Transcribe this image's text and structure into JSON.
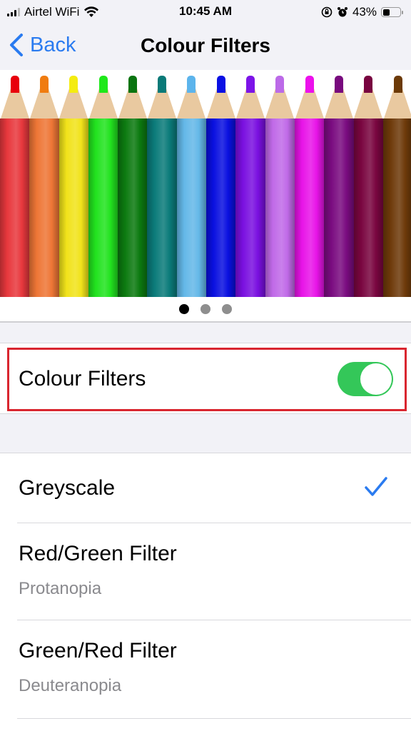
{
  "status_bar": {
    "carrier": "Airtel WiFi",
    "time": "10:45 AM",
    "battery_percent": "43%",
    "battery_level": 0.43,
    "icons": [
      "signal-icon",
      "wifi-icon",
      "orientation-lock-icon",
      "alarm-icon",
      "battery-icon"
    ]
  },
  "nav": {
    "back_label": "Back",
    "title": "Colour Filters"
  },
  "preview": {
    "pencil_colors": [
      "#e8383d",
      "#ee7636",
      "#f1e31a",
      "#22e31f",
      "#0c7a10",
      "#0b7b7a",
      "#64b8e8",
      "#0a10e0",
      "#7a10e0",
      "#c06ae8",
      "#e814e8",
      "#7a0c80",
      "#7a0640",
      "#6e3a0a"
    ],
    "lead_colors": [
      "#e8000c",
      "#f07c10",
      "#f4ec10",
      "#1ee81a",
      "#0a7410",
      "#0a7a78",
      "#5cb4ec",
      "#0a10e4",
      "#7c14e8",
      "#bc6ae8",
      "#ec10ec",
      "#780a7e",
      "#780440",
      "#6c3a08"
    ],
    "page_count": 3,
    "current_page": 1
  },
  "colour_filters": {
    "label": "Colour Filters",
    "enabled": true,
    "toggle_color": "#34c759",
    "highlight_color": "#d9262f"
  },
  "filters": [
    {
      "title": "Greyscale",
      "subtitle": "",
      "selected": true
    },
    {
      "title": "Red/Green Filter",
      "subtitle": "Protanopia",
      "selected": false
    },
    {
      "title": "Green/Red Filter",
      "subtitle": "Deuteranopia",
      "selected": false
    }
  ],
  "accent_color": "#2a7bf0"
}
